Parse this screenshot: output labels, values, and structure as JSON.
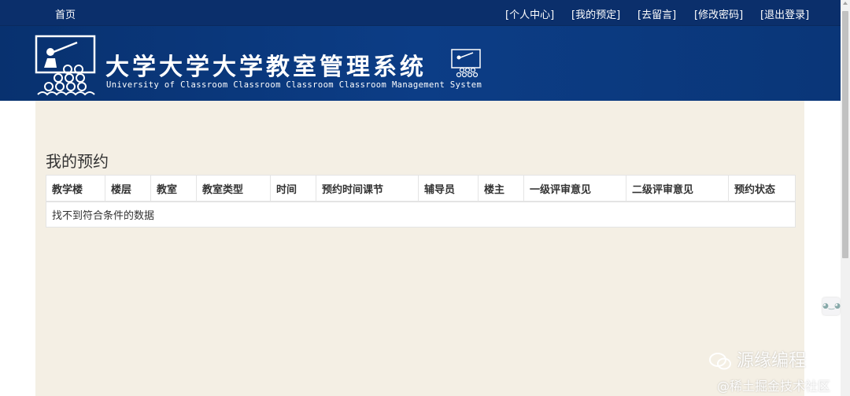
{
  "topnav": {
    "home": "首页",
    "links": [
      "[个人中心]",
      "[我的预定]",
      "[去留言]",
      "[修改密码]",
      "[退出登录]"
    ]
  },
  "banner": {
    "title_cn": "大学大学大学教室管理系统",
    "title_en": "University of Classroom Classroom Classroom Classroom Management System"
  },
  "main": {
    "heading": "我的预约",
    "table": {
      "columns": [
        "教学楼",
        "楼层",
        "教室",
        "教室类型",
        "时间",
        "预约时间课节",
        "辅导员",
        "楼主",
        "一级评审意见",
        "二级评审意见",
        "预约状态"
      ],
      "empty_text": "找不到符合条件的数据"
    }
  },
  "watermark": {
    "line1": "源缘编程",
    "line2": "@稀土掘金技术社区"
  },
  "colors": {
    "nav_bg": "#0b2f6b",
    "banner_bg": "#0a3678",
    "content_bg": "#f4efe4"
  },
  "icons": {
    "logo": "classroom-teacher-icon",
    "small_logo": "classroom-teacher-icon",
    "side_widget": "float-widget-icon",
    "watermark": "wechat-icon"
  }
}
